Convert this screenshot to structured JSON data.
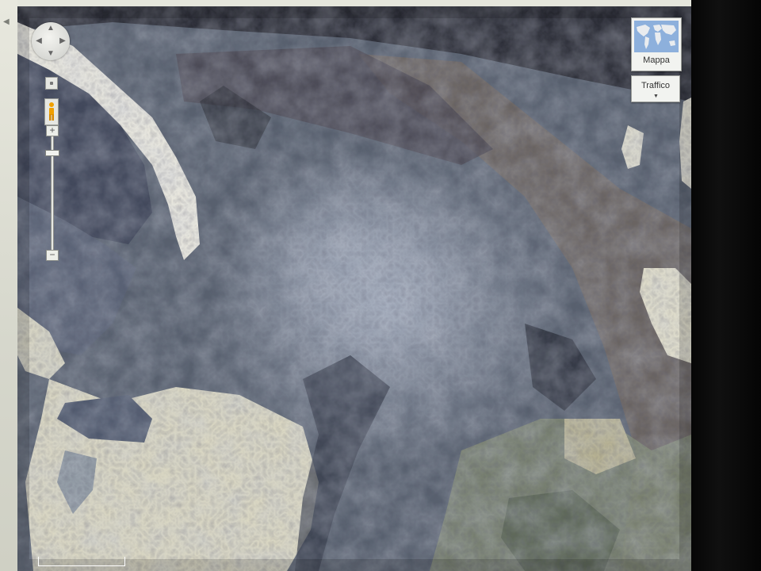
{
  "controls": {
    "map_type_label": "Mappa",
    "traffic_label": "Traffico",
    "scale_label": ""
  },
  "icons": {
    "pan": "pan-control-icon",
    "pegman": "street-view-pegman-icon",
    "zoom_in": "plus-icon",
    "zoom_out": "minus-icon",
    "map_thumb": "world-map-icon",
    "dropdown": "chevron-down-icon"
  },
  "colors": {
    "pegman": "#f0a000",
    "water_thumb": "#7fa6d8",
    "terrain_dark": "#4d5766"
  }
}
